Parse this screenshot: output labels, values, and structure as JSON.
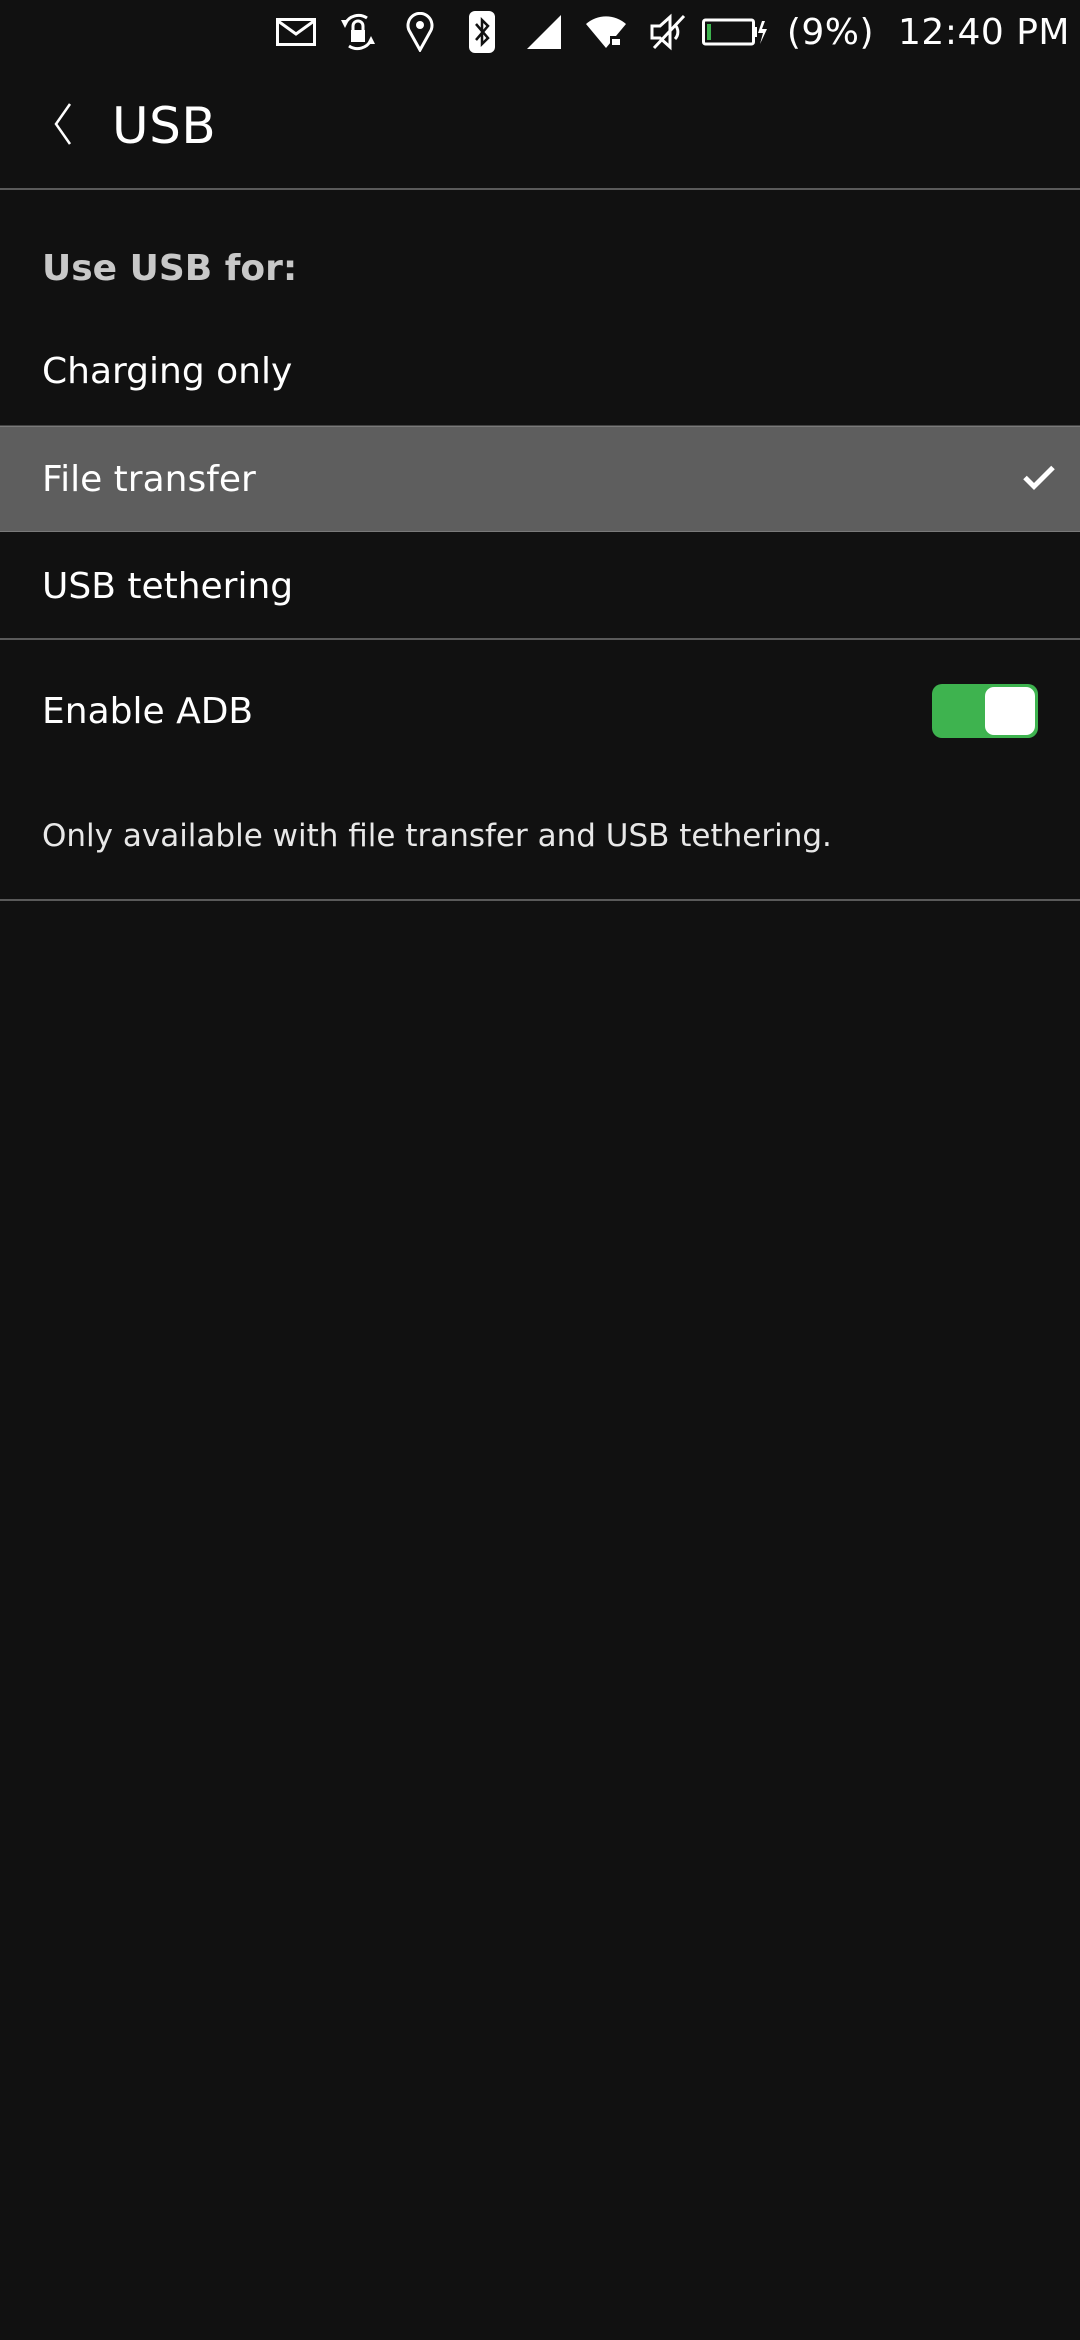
{
  "status_bar": {
    "icons": [
      "mail-icon",
      "rotation-lock-icon",
      "location-icon",
      "bluetooth-icon",
      "cellular-signal-icon",
      "wifi-icon",
      "muted-icon",
      "battery-icon"
    ],
    "battery_percent": "(9%)",
    "time": "12:40 PM",
    "battery_level": 0.09,
    "battery_color": "#3eb34f"
  },
  "header": {
    "title": "USB",
    "back_icon": "chevron-left-icon"
  },
  "usb_section": {
    "heading": "Use USB for:",
    "options": [
      {
        "label": "Charging only",
        "selected": false
      },
      {
        "label": "File transfer",
        "selected": true
      },
      {
        "label": "USB tethering",
        "selected": false
      }
    ],
    "selected_bg": "#5e5e5e"
  },
  "adb": {
    "label": "Enable ADB",
    "enabled": true,
    "toggle_color": "#3eb34f",
    "note": "Only available with file transfer and USB tethering."
  }
}
